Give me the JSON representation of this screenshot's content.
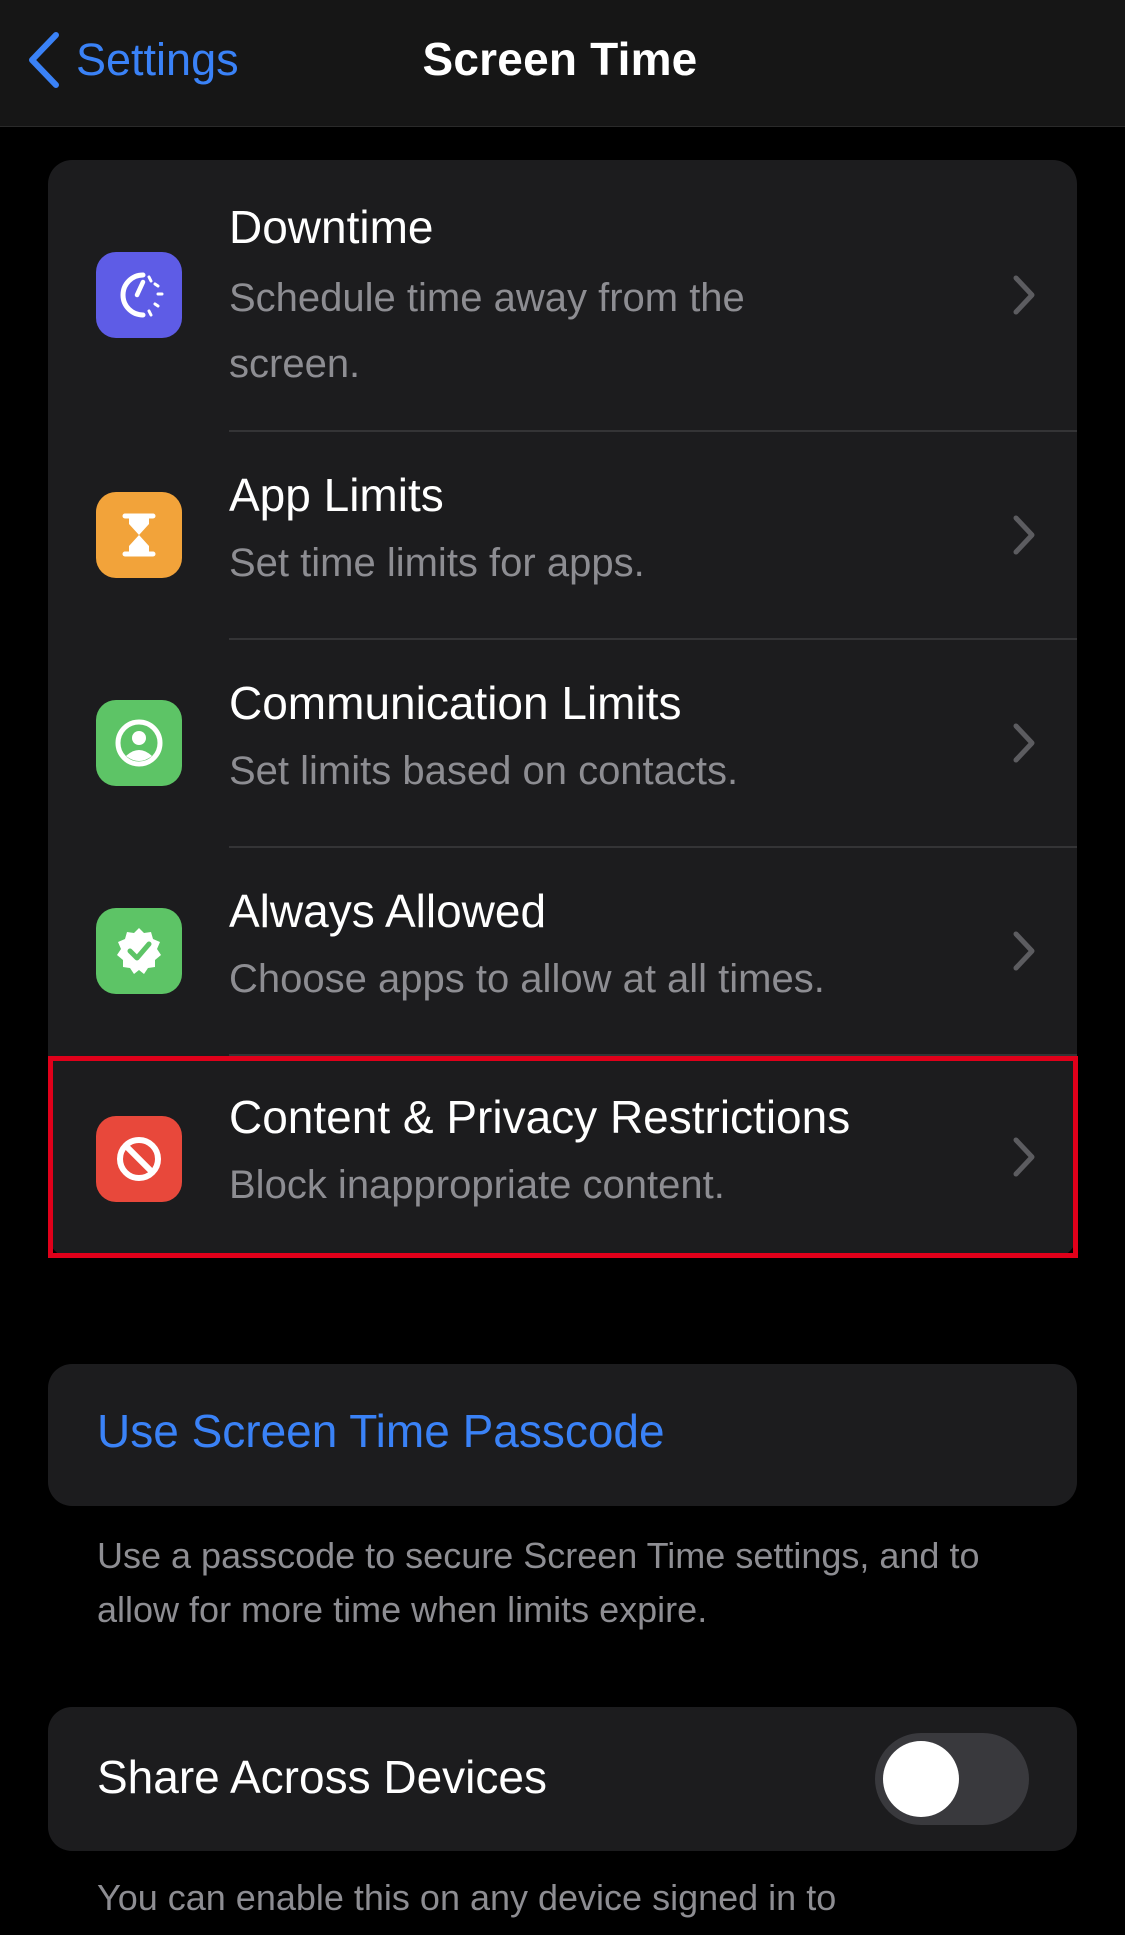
{
  "navbar": {
    "back_label": "Settings",
    "title": "Screen Time"
  },
  "colors": {
    "accent": "#3a82f7",
    "background": "#000000",
    "group_bg": "#1c1c1e",
    "highlight": "#e0001a"
  },
  "rows": [
    {
      "title": "Downtime",
      "subtitle": "Schedule time away from the screen.",
      "icon": "downtime-icon",
      "color": "#5e5ce6"
    },
    {
      "title": "App Limits",
      "subtitle": "Set time limits for apps.",
      "icon": "hourglass-icon",
      "color": "#f2a33a"
    },
    {
      "title": "Communication Limits",
      "subtitle": "Set limits based on contacts.",
      "icon": "contact-icon",
      "color": "#5dc466"
    },
    {
      "title": "Always Allowed",
      "subtitle": "Choose apps to allow at all times.",
      "icon": "checkmark-badge-icon",
      "color": "#5dc466"
    },
    {
      "title": "Content & Privacy Restrictions",
      "subtitle": "Block inappropriate content.",
      "icon": "prohibited-icon",
      "color": "#e8483b"
    }
  ],
  "passcode": {
    "link_label": "Use Screen Time Passcode",
    "footnote": "Use a passcode to secure Screen Time settings, and to allow for more time when limits expire."
  },
  "share": {
    "label": "Share Across Devices",
    "enabled": false,
    "footnote": "You can enable this on any device signed in to"
  }
}
